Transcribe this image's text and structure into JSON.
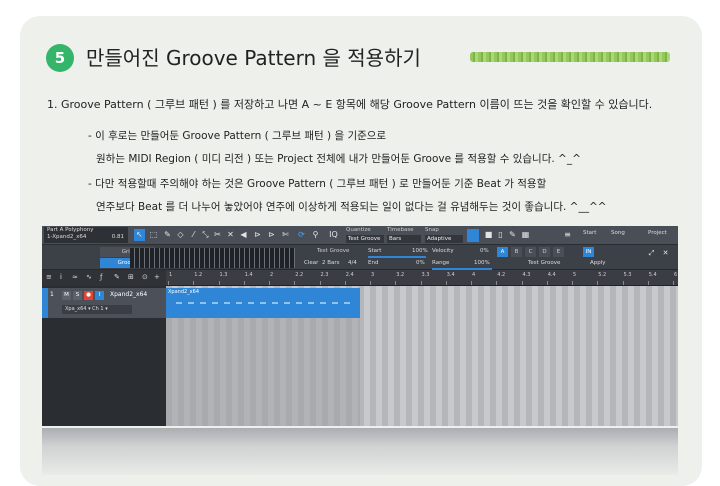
{
  "step": {
    "number": "5",
    "title": "만들어진 Groove Pattern 을 적용하기"
  },
  "line1": "1.  Groove Pattern ( 그루브 패턴 ) 를 저장하고 나면 A ~ E 항목에 해당 Groove Pattern 이름이 뜨는 것을 확인할 수 있습니다.",
  "notes": [
    "- 이 후로는 만들어둔 Groove Pattern ( 그루브 패턴 ) 을 기준으로",
    "원하는 MIDI Region ( 미디 리전 ) 또는 Project 전체에 내가 만들어둔 Groove 를 적용할 수 있습니다. ^_^",
    "- 다만 적용할때 주의해야 하는 것은 Groove Pattern ( 그루브 패턴 ) 로 만들어둔 기준 Beat 가 적용할",
    "연주보다 Beat 를 더 나누어 놓았어야 연주에 이상하게 적용되는 일이 없다는 걸 유념해두는 것이 좋습니다. ^__^^"
  ],
  "daw": {
    "part": {
      "name": "Part A Polyphony",
      "region": "1-Xpand2_x64",
      "value": "0.81"
    },
    "quantize": {
      "label": "Quantize",
      "value": "Test Groove"
    },
    "timebase": {
      "label": "Timebase",
      "value": "Bars"
    },
    "snap": {
      "label": "Snap",
      "value": "Adaptive"
    },
    "nav": {
      "start": "Start",
      "song": "Song",
      "project": "Project"
    },
    "grid_label": "Grid",
    "groove_label": "Groove",
    "groove_name": "Test Groove",
    "clear": "Clear",
    "bars": "2 Bars",
    "sig": "4/4",
    "start_label": "Start",
    "start_val": "100%",
    "end_label": "End",
    "end_val": "0%",
    "velocity_label": "Velocity",
    "velocity_val": "0%",
    "range_label": "Range",
    "range_val": "100%",
    "slots": [
      "A",
      "B",
      "C",
      "D",
      "E"
    ],
    "in_label": "IN",
    "apply": "Apply",
    "slot_select": "Test Groove",
    "ruler": [
      "1",
      "1.2",
      "1.3",
      "1.4",
      "2",
      "2.2",
      "2.3",
      "2.4",
      "3",
      "3.2",
      "3.3",
      "3.4",
      "4",
      "4.2",
      "4.3",
      "4.4",
      "5",
      "5.2",
      "5.3",
      "5.4",
      "6"
    ],
    "track": {
      "number": "1",
      "name": "Xpand2_x64",
      "instrument": "Xpa_x64 ▾  Ch 1  ▾",
      "m": "M",
      "s": "S",
      "i": "I"
    },
    "region_name": "Xpand2_x64"
  },
  "colors": {
    "accent": "#2f86d6",
    "step": "#35b56a"
  }
}
